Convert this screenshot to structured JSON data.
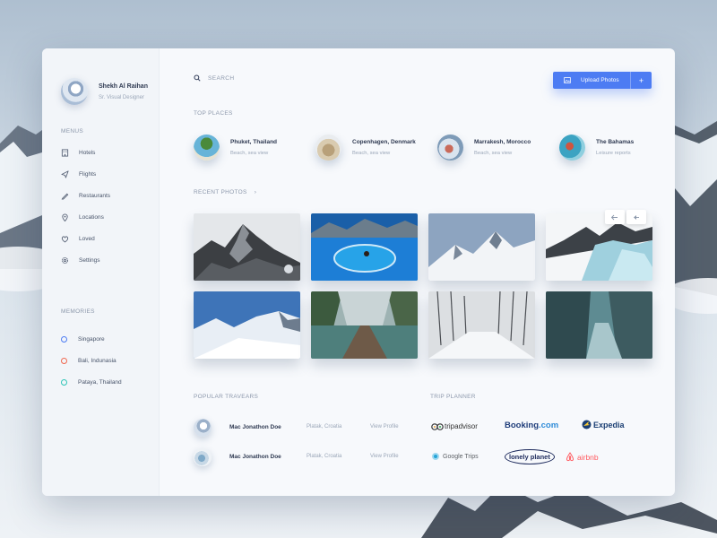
{
  "profile": {
    "name": "Shekh Al Raihan",
    "role": "Sr. Visual Designer"
  },
  "menus": {
    "title": "MENUS",
    "items": [
      {
        "label": "Hotels",
        "icon": "building-icon"
      },
      {
        "label": "Flights",
        "icon": "paper-plane-icon"
      },
      {
        "label": "Restaurants",
        "icon": "pen-icon"
      },
      {
        "label": "Locations",
        "icon": "map-pin-icon"
      },
      {
        "label": "Loved",
        "icon": "heart-icon"
      },
      {
        "label": "Settings",
        "icon": "gear-icon"
      }
    ]
  },
  "memories": {
    "title": "MEMORIES",
    "items": [
      {
        "label": "Singapore",
        "color": "#4d7cf3"
      },
      {
        "label": "Bali, Indunasia",
        "color": "#f0684f"
      },
      {
        "label": "Pataya, Thailand",
        "color": "#2ec4b6"
      }
    ]
  },
  "search": {
    "placeholder": "SEARCH"
  },
  "upload": {
    "label": "Upload Photos",
    "plus": "+"
  },
  "top_places": {
    "title": "TOP PLACES",
    "items": [
      {
        "name": "Phuket, Thailand",
        "sub": "Beach, sea view"
      },
      {
        "name": "Copenhagen, Denmark",
        "sub": "Beach, sea view"
      },
      {
        "name": "Marrakesh, Morocco",
        "sub": "Beach, sea view"
      },
      {
        "name": "The Bahamas",
        "sub": "Leisure reports"
      }
    ]
  },
  "recent_photos": {
    "title": "RECENT PHOTOS",
    "arrow": "›"
  },
  "popular": {
    "title": "POPULAR TRAVEARS",
    "items": [
      {
        "name": "Mac Jonathon Doe",
        "location": "Platak, Croatia",
        "link": "View Profile"
      },
      {
        "name": "Mac Jonathon Doe",
        "location": "Platak, Croatia",
        "link": "View Profile"
      }
    ]
  },
  "trip_planner": {
    "title": "TRIP PLANNER",
    "logos": {
      "tripadvisor": "tripadvisor",
      "booking": "Booking",
      "booking_suffix": ".com",
      "expedia": "Expedia",
      "google_trips": "Google Trips",
      "lonely_planet": "lonely planet",
      "airbnb": "airbnb"
    }
  },
  "colors": {
    "accent": "#4d7cf3",
    "heading": "#2f3a52",
    "muted": "#9aa6b8"
  }
}
